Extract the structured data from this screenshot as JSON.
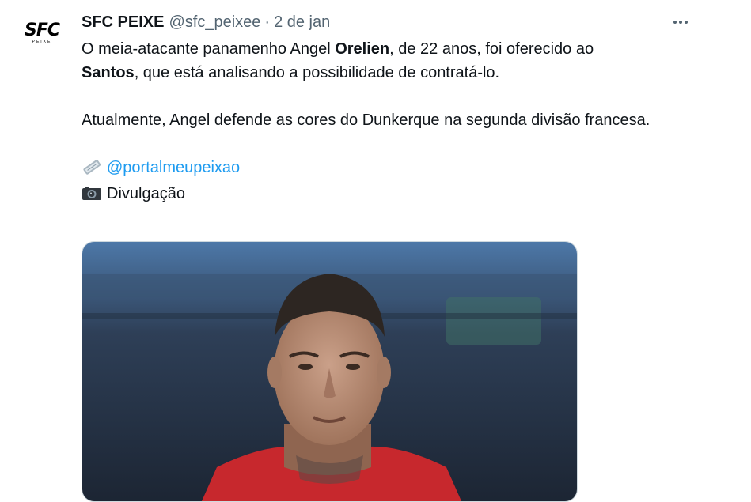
{
  "tweet": {
    "author_name": "SFC PEIXE",
    "handle": "@sfc_peixee",
    "separator": "·",
    "date": "2 de jan",
    "avatar_text": "SFC",
    "avatar_subtext": "PEIXE",
    "line1_pre": "O meia-atacante panamenho Angel ",
    "line1_bold": "Orelien",
    "line1_post": ", de 22 anos, foi oferecido ao",
    "line2_bold": "Santos",
    "line2_post": ", que está analisando a possibilidade de contratá-lo.",
    "paragraph2": "Atualmente, Angel defende as cores do Dunkerque na segunda divisão francesa.",
    "mention": "@portalmeupeixao",
    "credit": "Divulgação",
    "icons": [
      "newspaper-icon",
      "camera-icon",
      "more-options-icon"
    ],
    "colors": {
      "link": "#1d9bf0",
      "secondary": "#536471",
      "text": "#0f1419"
    }
  }
}
